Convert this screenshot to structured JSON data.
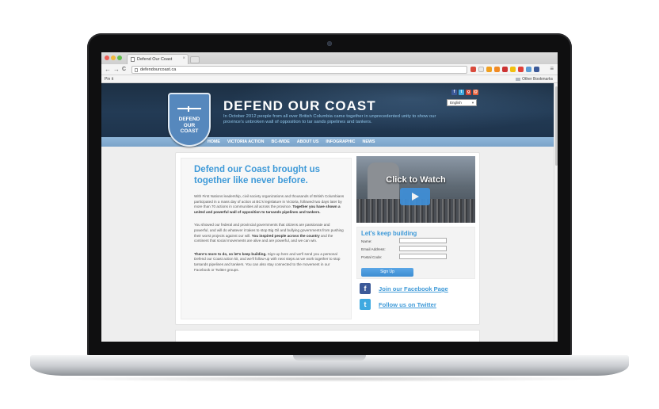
{
  "browser": {
    "tab_title": "Defend Our Coast",
    "tab_close": "×",
    "url": "defendourcoast.ca",
    "back": "←",
    "forward": "→",
    "reload": "C",
    "menu": "≡",
    "bookmarks": {
      "pin_it": "Pin it",
      "other_bookmarks": "Other Bookmarks"
    }
  },
  "site": {
    "logo_text": "DEFEND\nOUR\nCOAST",
    "title": "DEFEND OUR COAST",
    "tagline": "In October 2012 people from all over British Columbia came together in unprecedented unity to show our province's unbroken wall of opposition to tar sands pipelines and tankers.",
    "language": "English",
    "nav": [
      "HOME",
      "VICTORIA ACTION",
      "BC-WIDE",
      "ABOUT US",
      "INFOGRAPHIC",
      "NEWS"
    ]
  },
  "main": {
    "headline": "Defend our Coast brought us together like never before.",
    "p1_text": "With First Nations leadership, civil society organizations and thousands of British Columbians participated in a mass day of action at BC's legislature in Victoria, followed two days later by more than 70 actions in communities all across the province. ",
    "p1_bold": "Together you have shown a united and powerful wall of opposition to tarsands pipelines and tankers.",
    "p2_text": "You showed our federal and provincial governments that citizens are passionate and powerful, and will do whatever it takes to stop Big Oil and bullying governments from pushing their worst projects against our will. ",
    "p2_bold": "You inspired people across the country",
    "p2_text2": " and the continent that social movements are alive and are powerful, and we can win.",
    "p3_bold": "There's more to do, so let's keep building.",
    "p3_text": " Sign-up here and we'll send you a personal Defend our Coast action kit, and we'll follow-up with next steps as we work together to stop tarsands pipelines and tankers. You can also stay connected to the movement in our Facebook or Twitter groups."
  },
  "video": {
    "title": "Click to Watch"
  },
  "form": {
    "title": "Let's keep building",
    "name_label": "Name:",
    "email_label": "Email Address:",
    "postal_label": "Postal Code:",
    "submit": "Sign Up"
  },
  "social": {
    "facebook_label": "Join our Facebook Page",
    "twitter_label": "Follow us on Twitter",
    "facebook_glyph": "f",
    "twitter_glyph": "t"
  },
  "colors": {
    "accent": "#3f9ad8",
    "header_bg": "#1d3044",
    "nav_bg": "#8fb6d9",
    "facebook": "#3b5998",
    "twitter": "#3fa9e0"
  },
  "icons": [
    "tab-favicon",
    "close-icon",
    "back-arrow-icon",
    "forward-arrow-icon",
    "reload-icon",
    "page-icon",
    "menu-icon",
    "folder-icon",
    "facebook-icon",
    "twitter-icon",
    "google-plus-icon",
    "play-icon",
    "boat-icon"
  ]
}
